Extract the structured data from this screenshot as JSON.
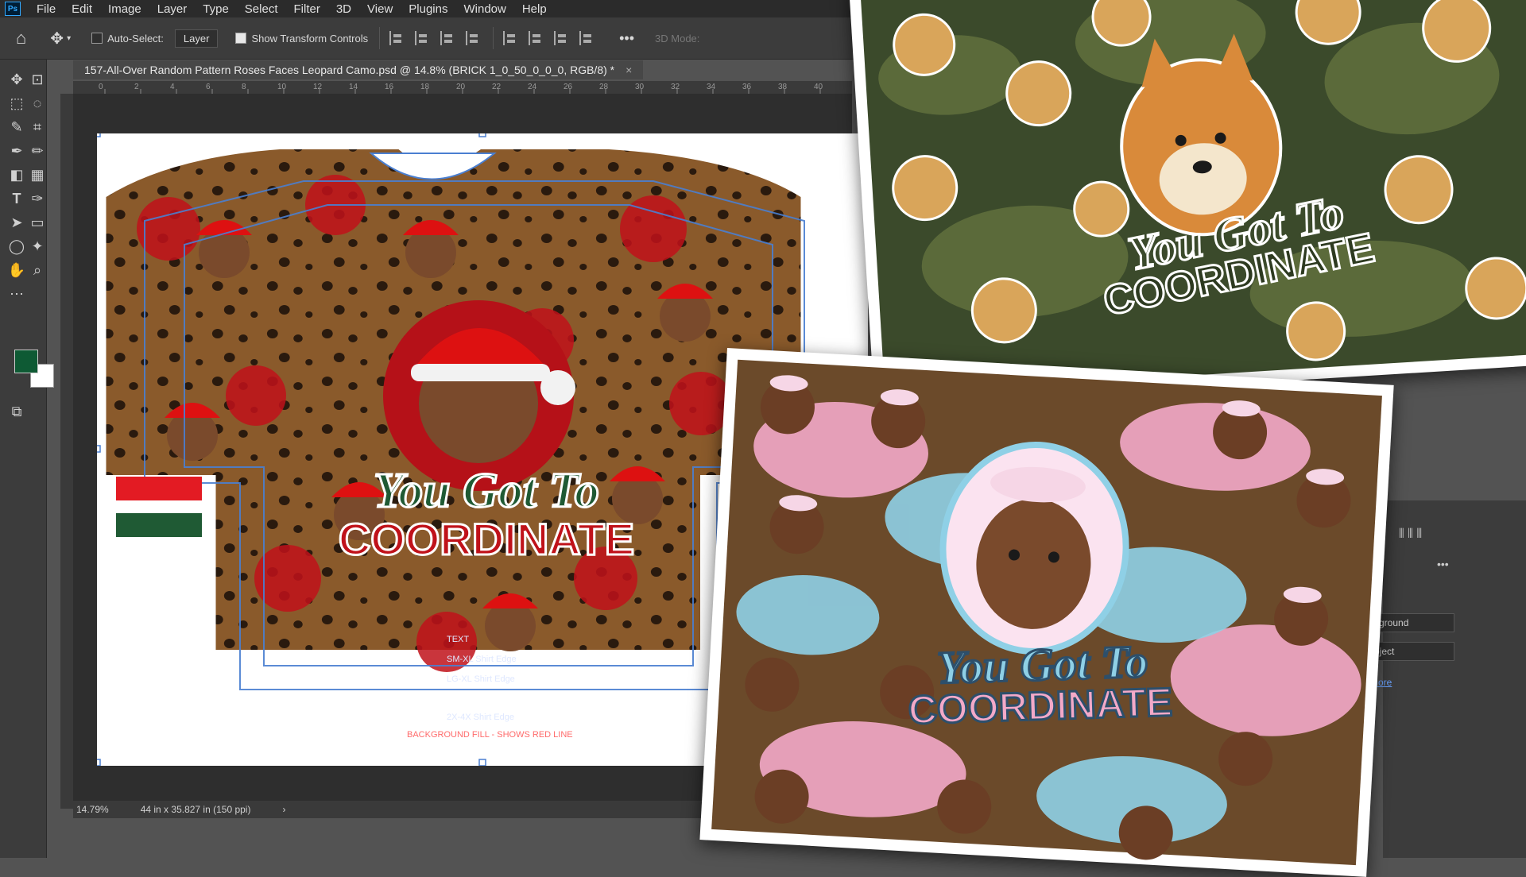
{
  "app": {
    "logo": "Ps"
  },
  "menu": [
    "File",
    "Edit",
    "Image",
    "Layer",
    "Type",
    "Select",
    "Filter",
    "3D",
    "View",
    "Plugins",
    "Window",
    "Help"
  ],
  "options": {
    "auto_select_label": "Auto-Select:",
    "layer_dropdown": "Layer",
    "transform_label": "Show Transform Controls",
    "mode_label": "3D Mode:"
  },
  "document": {
    "tab_title": "157-All-Over Random Pattern Roses Faces Leopard Camo.psd @ 14.8% (BRICK 1_0_50_0_0_0, RGB/8) *",
    "close_glyph": "×"
  },
  "ruler_ticks": [
    "0",
    "2",
    "4",
    "6",
    "8",
    "10",
    "12",
    "14",
    "16",
    "18",
    "20",
    "22",
    "24",
    "26",
    "28",
    "30",
    "32",
    "34",
    "36",
    "38",
    "40"
  ],
  "status": {
    "zoom": "14.79%",
    "size": "44 in x 35.827 in (150 ppi)",
    "arrow": "›"
  },
  "design": {
    "line1": "You Got To",
    "line2": "COORDINATE",
    "guide1": "TEXT",
    "guide2": "SM-XL Shirt Edge",
    "guide3": "LG-XL Shirt Edge",
    "guide4": "2X-4X Shirt Edge",
    "guide5": "BACKGROUND FILL - SHOWS RED LINE"
  },
  "swatches": {
    "foreground": "#0e5a34",
    "background": "#ffffff"
  },
  "right_panel": {
    "field1": "kground",
    "field2": "bject",
    "more_link": "More",
    "dots": "•••"
  },
  "colors": {
    "accent": "#31a8ff",
    "red_flag": "#e31b23",
    "green_flag": "#1f5a34",
    "camo_dark": "#3b4a2b",
    "pastel_pink": "#f3a9c8",
    "pastel_blue": "#8fd0e6"
  }
}
